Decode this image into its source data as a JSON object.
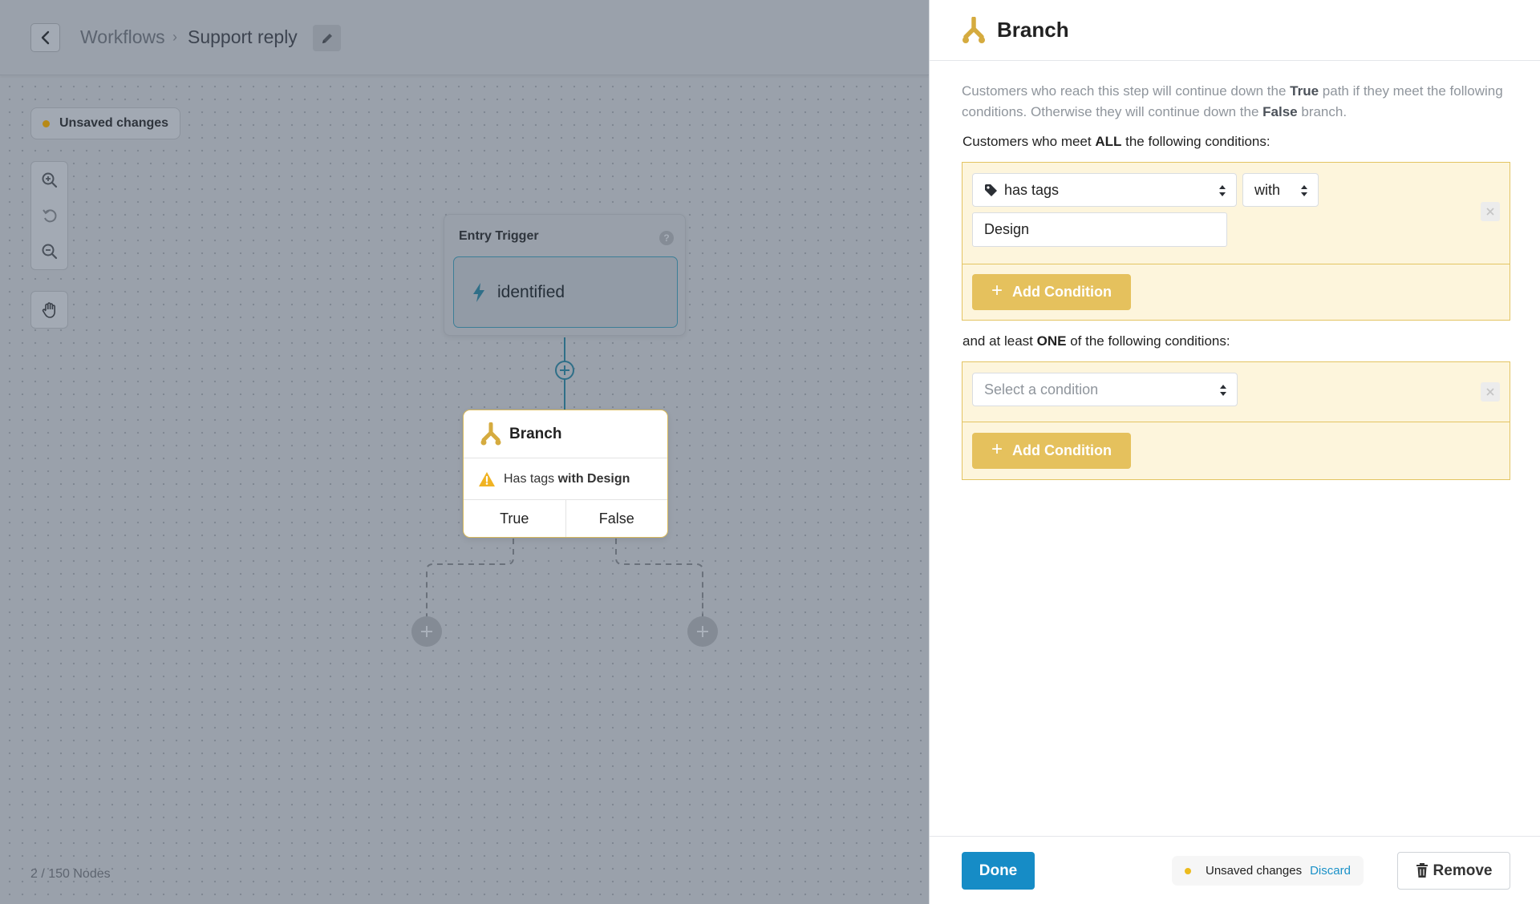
{
  "header": {
    "back_icon": "chevron-left-icon",
    "breadcrumb_root": "Workflows",
    "breadcrumb_separator": "›",
    "breadcrumb_current": "Support reply",
    "edit_icon": "pencil-icon"
  },
  "canvas": {
    "unsaved_label": "Unsaved changes",
    "tools": [
      "zoom-in-icon",
      "reset-view-icon",
      "zoom-out-icon",
      "hand-pan-icon"
    ],
    "node_count": "2 / 150 Nodes",
    "trigger": {
      "title": "Entry Trigger",
      "help": "?",
      "event": "identified"
    },
    "branch_node": {
      "title": "Branch",
      "summary_prefix": "Has tags",
      "summary_strong": "with Design",
      "true_label": "True",
      "false_label": "False"
    }
  },
  "panel": {
    "title": "Branch",
    "description": {
      "p1": "Customers who reach this step will continue down the ",
      "true_word": "True",
      "p2": " path if they meet the following conditions. Otherwise they will continue down the ",
      "false_word": "False",
      "p3": " branch."
    },
    "all_label": {
      "pre": "Customers who meet ",
      "strong": "ALL",
      "post": " the following conditions:"
    },
    "one_label": {
      "pre": "and at least ",
      "strong": "ONE",
      "post": " of the following conditions:"
    },
    "condition_1": {
      "field": "has tags",
      "operator": "with",
      "value": "Design"
    },
    "condition_2": {
      "placeholder": "Select a condition"
    },
    "add_condition_label": "Add Condition",
    "footer": {
      "done": "Done",
      "unsaved": "Unsaved changes",
      "discard": "Discard",
      "remove": "Remove"
    }
  },
  "colors": {
    "brand_gold": "#e5c15d",
    "primary_blue": "#168cc6",
    "connector_teal": "#2f6f88"
  }
}
